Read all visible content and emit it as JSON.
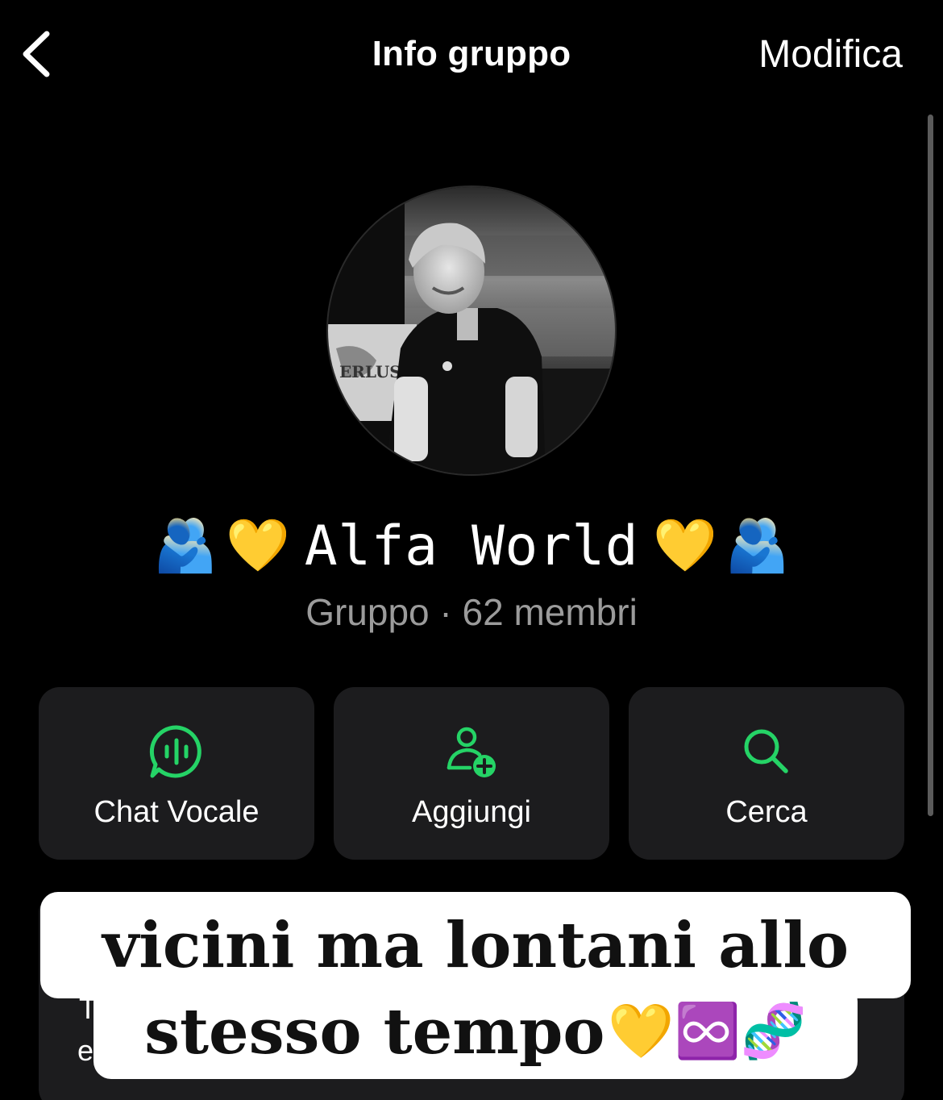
{
  "nav": {
    "title": "Info gruppo",
    "edit_label": "Modifica"
  },
  "group": {
    "emoji_left_outer": "🫂",
    "emoji_left_inner": "💛",
    "name": "Alfa World",
    "emoji_right_inner": "💛",
    "emoji_right_outer": "🫂",
    "subtitle": "Gruppo · 62 membri",
    "avatar_banner_text": "ERLUS"
  },
  "actions": [
    {
      "label": "Chat Vocale",
      "icon": "voice-chat-icon"
    },
    {
      "label": "Aggiungi",
      "icon": "add-person-icon"
    },
    {
      "label": "Cerca",
      "icon": "search-icon"
    }
  ],
  "caption": {
    "line1": "vicini ma lontani allo",
    "line2": "stesso tempo",
    "line2_emojis": "💛♾️🧬"
  },
  "description_fragment": {
    "char1": "T",
    "char2": "e"
  },
  "colors": {
    "accent": "#25D366",
    "background": "#000000",
    "card": "#1c1c1e",
    "secondary_text": "#9b9b9b"
  }
}
